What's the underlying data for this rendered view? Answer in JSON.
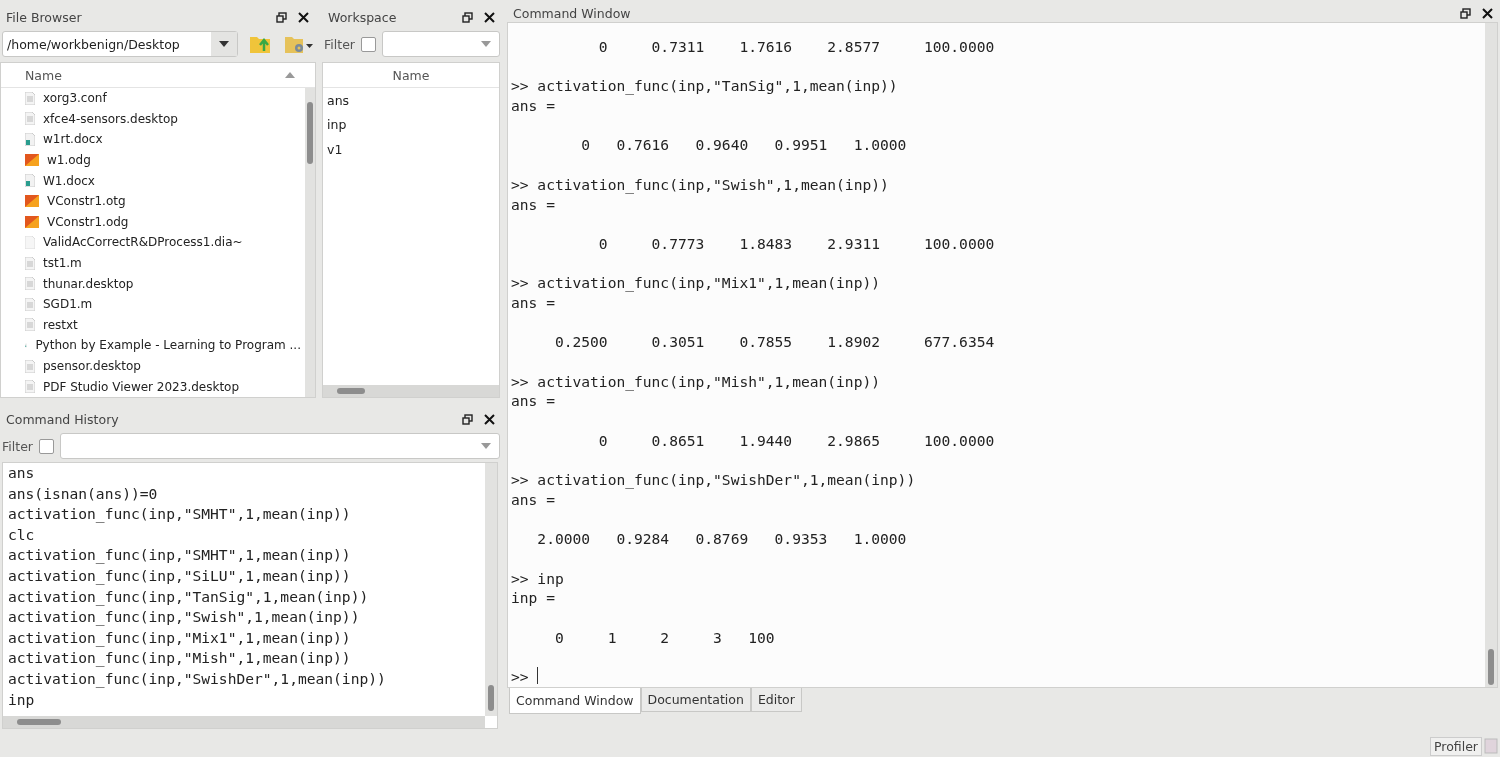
{
  "file_browser": {
    "title": "File Browser",
    "path": "/home/workbenign/Desktop",
    "column": "Name",
    "files": [
      {
        "name": "xorg3.conf",
        "kind": "text"
      },
      {
        "name": "xfce4-sensors.desktop",
        "kind": "text"
      },
      {
        "name": "w1rt.docx",
        "kind": "document"
      },
      {
        "name": "w1.odg",
        "kind": "drawing"
      },
      {
        "name": "W1.docx",
        "kind": "document"
      },
      {
        "name": "VConstr1.otg",
        "kind": "drawing"
      },
      {
        "name": "VConstr1.odg",
        "kind": "drawing"
      },
      {
        "name": "ValidAcCorrectR&DProcess1.dia~",
        "kind": "blank"
      },
      {
        "name": "tst1.m",
        "kind": "text"
      },
      {
        "name": "thunar.desktop",
        "kind": "text"
      },
      {
        "name": "SGD1.m",
        "kind": "text"
      },
      {
        "name": "restxt",
        "kind": "text"
      },
      {
        "name": "Python by Example - Learning to Program ...",
        "kind": "document"
      },
      {
        "name": "psensor.desktop",
        "kind": "text"
      },
      {
        "name": "PDF Studio Viewer 2023.desktop",
        "kind": "text"
      }
    ]
  },
  "workspace": {
    "title": "Workspace",
    "filter_label": "Filter",
    "filter_checked": false,
    "column": "Name",
    "variables": [
      "ans",
      "inp",
      "v1"
    ]
  },
  "command_history": {
    "title": "Command History",
    "filter_label": "Filter",
    "filter_checked": false,
    "entries": [
      "ans",
      "ans(isnan(ans))=0",
      "activation_func(inp,\"SMHT\",1,mean(inp))",
      "clc",
      "activation_func(inp,\"SMHT\",1,mean(inp))",
      "activation_func(inp,\"SiLU\",1,mean(inp))",
      "activation_func(inp,\"TanSig\",1,mean(inp))",
      "activation_func(inp,\"Swish\",1,mean(inp))",
      "activation_func(inp,\"Mix1\",1,mean(inp))",
      "activation_func(inp,\"Mish\",1,mean(inp))",
      "activation_func(inp,\"SwishDer\",1,mean(inp))",
      "inp"
    ]
  },
  "command_window": {
    "title": "Command Window",
    "lines": [
      {
        "kind": "output",
        "text": "          0     0.7311    1.7616    2.8577     100.0000"
      },
      {
        "kind": "blank"
      },
      {
        "kind": "prompt",
        "prompt": ">>",
        "text": "activation_func(inp,\"TanSig\",1,mean(inp))"
      },
      {
        "kind": "output",
        "text": "ans ="
      },
      {
        "kind": "blank"
      },
      {
        "kind": "output",
        "text": "        0   0.7616   0.9640   0.9951   1.0000"
      },
      {
        "kind": "blank"
      },
      {
        "kind": "prompt",
        "prompt": ">>",
        "text": "activation_func(inp,\"Swish\",1,mean(inp))"
      },
      {
        "kind": "output",
        "text": "ans ="
      },
      {
        "kind": "blank"
      },
      {
        "kind": "output",
        "text": "          0     0.7773    1.8483    2.9311     100.0000"
      },
      {
        "kind": "blank"
      },
      {
        "kind": "prompt",
        "prompt": ">>",
        "text": "activation_func(inp,\"Mix1\",1,mean(inp))"
      },
      {
        "kind": "output",
        "text": "ans ="
      },
      {
        "kind": "blank"
      },
      {
        "kind": "output",
        "text": "     0.2500     0.3051    0.7855    1.8902     677.6354"
      },
      {
        "kind": "blank"
      },
      {
        "kind": "prompt",
        "prompt": ">>",
        "text": "activation_func(inp,\"Mish\",1,mean(inp))"
      },
      {
        "kind": "output",
        "text": "ans ="
      },
      {
        "kind": "blank"
      },
      {
        "kind": "output",
        "text": "          0     0.8651    1.9440    2.9865     100.0000"
      },
      {
        "kind": "blank"
      },
      {
        "kind": "prompt",
        "prompt": ">>",
        "text": "activation_func(inp,\"SwishDer\",1,mean(inp))"
      },
      {
        "kind": "output",
        "text": "ans ="
      },
      {
        "kind": "blank"
      },
      {
        "kind": "output",
        "text": "   2.0000   0.9284   0.8769   0.9353   1.0000"
      },
      {
        "kind": "blank"
      },
      {
        "kind": "prompt",
        "prompt": ">>",
        "text": "inp"
      },
      {
        "kind": "output",
        "text": "inp ="
      },
      {
        "kind": "blank"
      },
      {
        "kind": "output",
        "text": "     0     1     2     3   100"
      },
      {
        "kind": "blank"
      },
      {
        "kind": "input",
        "prompt": ">>"
      }
    ],
    "tabs": [
      {
        "label": "Command Window",
        "selected": true
      },
      {
        "label": "Documentation",
        "selected": false
      },
      {
        "label": "Editor",
        "selected": false
      }
    ]
  },
  "status_bar": {
    "profiler": "Profiler"
  }
}
